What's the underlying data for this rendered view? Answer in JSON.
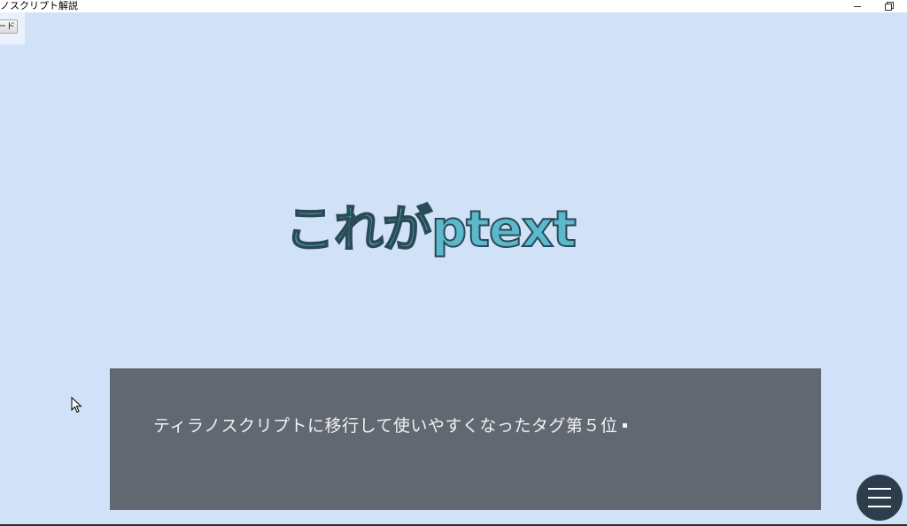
{
  "window": {
    "title": "ノスクリプト解説",
    "minimize_icon": "minimize-icon",
    "restore_icon": "restore-icon"
  },
  "toolbar": {
    "button_label": "ード"
  },
  "scene": {
    "heading": "これがptext",
    "heading_color": "#5cb8cc",
    "background_color": "#d1e2f8"
  },
  "message_window": {
    "text": "ティラノスクリプトに移行して使いやすくなったタグ第５位",
    "background_color": "#616872",
    "continue_icon": "continue-indicator-icon"
  },
  "menu": {
    "icon": "hamburger-menu-icon",
    "background_color": "#2e3d4c"
  }
}
